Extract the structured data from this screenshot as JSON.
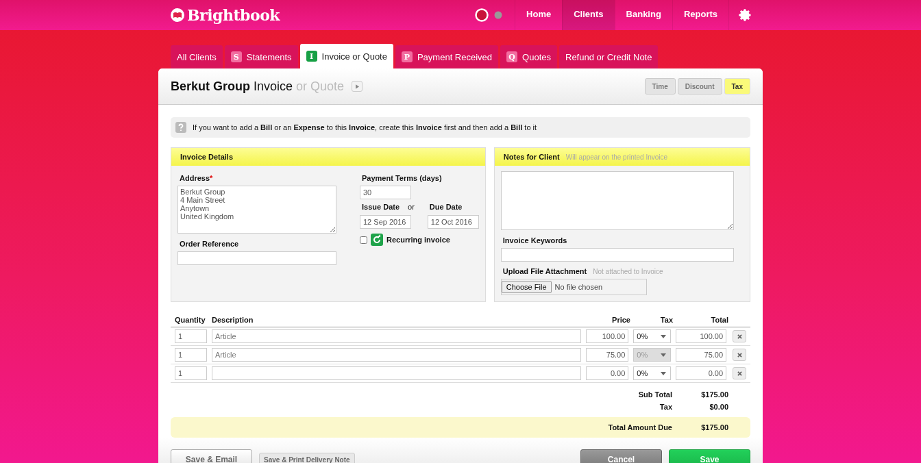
{
  "brand": "Brightbook",
  "nav": [
    {
      "label": "Home",
      "selected": false
    },
    {
      "label": "Clients",
      "selected": true
    },
    {
      "label": "Banking",
      "selected": false
    },
    {
      "label": "Reports",
      "selected": false
    }
  ],
  "tabs": [
    {
      "label": "All Clients",
      "selected": false
    },
    {
      "label": "Statements",
      "letter": "S",
      "selected": false
    },
    {
      "label": "Invoice or Quote",
      "letter": "I",
      "selected": true
    },
    {
      "label": "Payment Received",
      "letter": "P",
      "selected": false
    },
    {
      "label": "Quotes",
      "letter": "Q",
      "selected": false
    },
    {
      "label": "Refund or Credit Note",
      "selected": false
    }
  ],
  "header": {
    "client": "Berkut Group",
    "doc_type": "Invoice",
    "alt_type": "or Quote"
  },
  "toggles": [
    {
      "label": "Time",
      "on": false
    },
    {
      "label": "Discount",
      "on": false
    },
    {
      "label": "Tax",
      "on": true
    }
  ],
  "hint": "If you want to add a **Bill** or an **Expense** to this **Invoice**, create this **Invoice** first and then add a **Bill** to it",
  "details": {
    "title": "Invoice Details",
    "address_label": "Address",
    "required_mark": "*",
    "address": "Berkut Group\n4 Main Street\nAnytown\nUnited Kingdom",
    "order_label": "Order Reference",
    "terms_label": "Payment Terms (days)",
    "terms": "30",
    "issue_label": "Issue Date",
    "or": "or",
    "due_label": "Due Date",
    "issue_date": "12 Sep 2016",
    "due_date": "12 Oct 2016",
    "recurring_label": "Recurring invoice",
    "recurring": false
  },
  "notes": {
    "title": "Notes for Client",
    "subtitle": "Will appear on the printed Invoice",
    "keywords_label": "Invoice Keywords",
    "upload_label": "Upload File Attachment",
    "upload_note": "Not attached to Invoice",
    "choose_button": "Choose File",
    "file_status": "No file chosen"
  },
  "columns": [
    "Quantity",
    "Description",
    "Price",
    "Tax",
    "Total"
  ],
  "lines": [
    {
      "quantity": "1",
      "description": "Article",
      "price": "100.00",
      "tax": "0%",
      "disabled": false,
      "total": "100.00"
    },
    {
      "quantity": "1",
      "description": "Article",
      "price": "75.00",
      "tax": "0%",
      "disabled": true,
      "total": "75.00"
    },
    {
      "quantity": "1",
      "price": "0.00",
      "tax": "0%",
      "disabled": false,
      "total": "0.00"
    }
  ],
  "totals": [
    {
      "label": "Sub Total",
      "value": "$175.00"
    },
    {
      "label": "Tax",
      "value": "$0.00"
    }
  ],
  "grand_total": {
    "label": "Total Amount Due",
    "value": "$175.00"
  },
  "actions": {
    "save_email": "Save & Email",
    "delivery": "Save & Print Delivery Note",
    "cancel": "Cancel",
    "save": "Save"
  }
}
